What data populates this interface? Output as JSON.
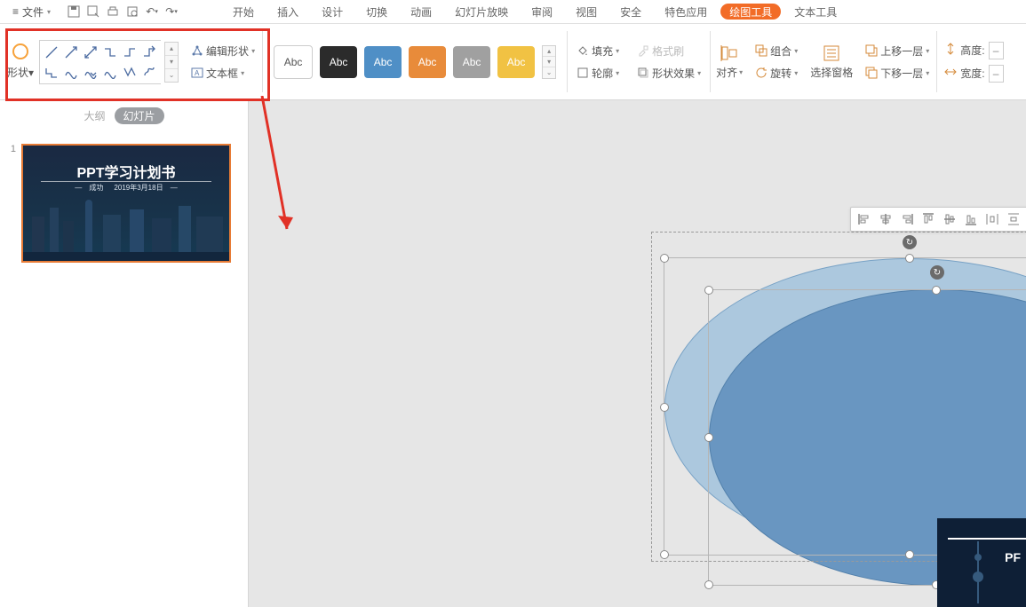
{
  "menubar": {
    "file_label": "文件",
    "tabs": [
      "开始",
      "插入",
      "设计",
      "切换",
      "动画",
      "幻灯片放映",
      "审阅",
      "视图",
      "安全",
      "特色应用"
    ],
    "tool_tab_draw": "绘图工具",
    "tool_tab_text": "文本工具"
  },
  "ribbon": {
    "shapes_label": "形状",
    "edit_shape": "编辑形状",
    "text_box": "文本框",
    "style_swatches": [
      "Abc",
      "Abc",
      "Abc",
      "Abc",
      "Abc",
      "Abc"
    ],
    "fill": "填充",
    "outline": "轮廓",
    "format_paint": "格式刷",
    "shape_effect": "形状效果",
    "align": "对齐",
    "group": "组合",
    "rotate": "旋转",
    "selection_pane": "选择窗格",
    "bring_forward": "上移一层",
    "send_backward": "下移一层",
    "height": "高度:",
    "width": "宽度:",
    "size_placeholder": "–"
  },
  "left_panel": {
    "outline_tab": "大纲",
    "slides_tab": "幻灯片",
    "slide_number": "1",
    "thumb_title": "PPT学习计划书",
    "thumb_sub_a": "成功",
    "thumb_sub_b": "2019年3月18日"
  },
  "mini_preview": {
    "pp": "PF"
  }
}
